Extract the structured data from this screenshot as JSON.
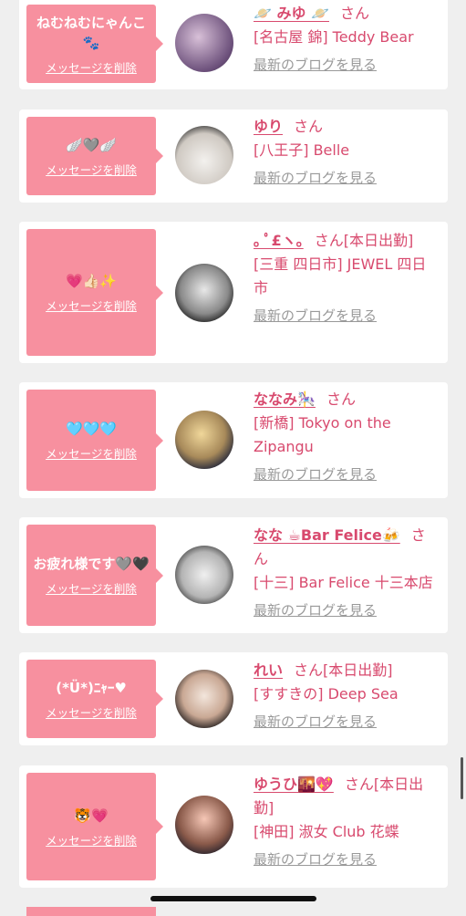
{
  "delete_label": "メッセージを削除",
  "blog_label": "最新のブログを見る",
  "san_suffix": "さん",
  "colors": {
    "accent": "#d84a6e",
    "bubble": "#f7909f",
    "blog_link": "#999999",
    "background": "#efefef"
  },
  "cards": [
    {
      "message": "ねむねむにゃんこ🐾",
      "name": "🪐 みゆ 🪐",
      "status": "",
      "shop": "[名古屋 錦] Teddy Bear"
    },
    {
      "message": "🪽🩶🪽",
      "name": "ゆり",
      "status": "",
      "shop": "[八王子] Belle"
    },
    {
      "message": "💗👍🏻✨",
      "name": "｡ ﾟ£ヽ｡",
      "status": "[本日出勤]",
      "shop": "[三重 四日市] JEWEL 四日市"
    },
    {
      "message": "🩵🩵🩵",
      "name": "ななみ🎠",
      "status": "",
      "shop": "[新橋] Tokyo on the Zipangu"
    },
    {
      "message": "お疲れ様です🩶🖤",
      "name": "なな ☕Bar Felice🍻",
      "status": "",
      "shop": "[十三] Bar Felice 十三本店"
    },
    {
      "message": "(*Ü*)ﾆｬｰ♥",
      "name": "れい",
      "status": "[本日出勤]",
      "shop": "[すすきの] Deep Sea"
    },
    {
      "message": "🐯💗",
      "name": "ゆうひ🌇💖",
      "status": "[本日出勤]",
      "shop": "[神田] 淑女 Club 花蝶"
    }
  ]
}
